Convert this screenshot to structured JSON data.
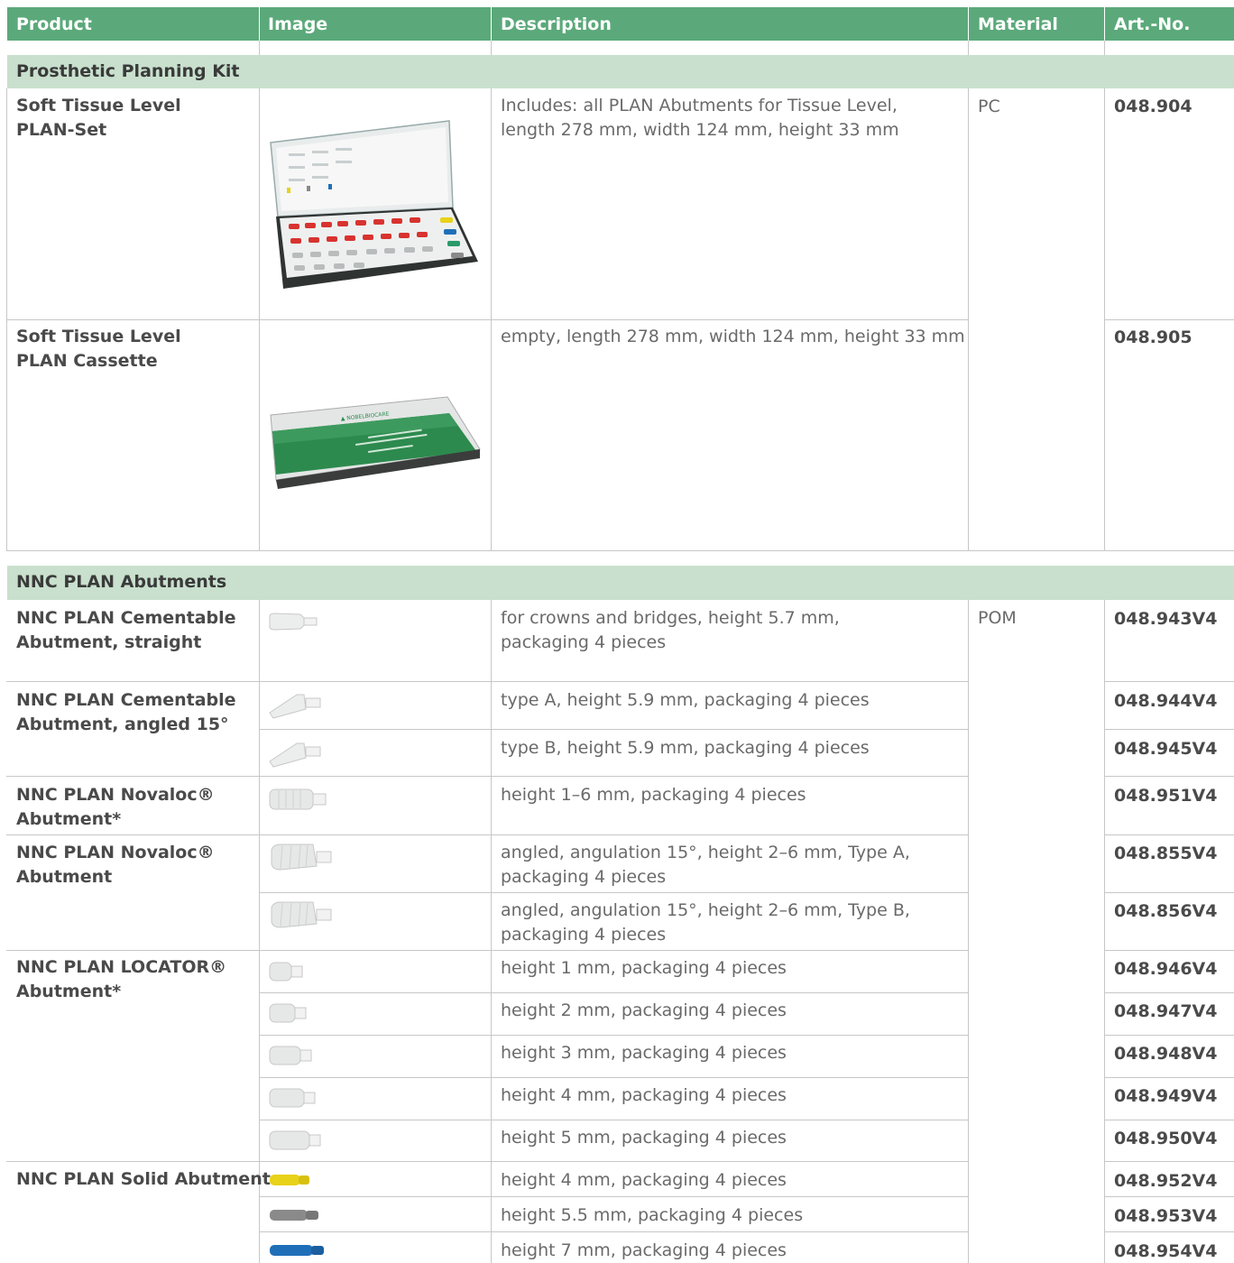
{
  "header": {
    "product": "Product",
    "image": "Image",
    "description": "Description",
    "material": "Material",
    "art_no": "Art.-No."
  },
  "section1": {
    "title": "Prosthetic Planning Kit",
    "rows": [
      {
        "product": [
          "Soft Tissue Level",
          "PLAN-Set"
        ],
        "description": [
          "Includes: all PLAN Abutments for Tissue Level,",
          "length 278 mm, width 124 mm, height 33 mm"
        ],
        "material": "PC",
        "art": "048.904",
        "image": "plan-set-kit-photo"
      },
      {
        "product": [
          "Soft Tissue Level",
          "PLAN Cassette"
        ],
        "description": [
          "empty, length 278 mm, width 124 mm, height 33 mm"
        ],
        "art": "048.905",
        "image": "plan-cassette-photo"
      }
    ]
  },
  "section2": {
    "title": "NNC PLAN Abutments",
    "material": "POM",
    "groups": [
      {
        "product": [
          "NNC PLAN Cementable",
          "Abutment, straight"
        ]
      },
      {
        "product": [
          "NNC PLAN Cementable",
          "Abutment, angled 15°"
        ]
      },
      {
        "product": [
          "NNC PLAN Novaloc®",
          "Abutment*"
        ]
      },
      {
        "product": [
          "NNC PLAN Novaloc®",
          "Abutment"
        ]
      },
      {
        "product": [
          "NNC PLAN LOCATOR®",
          "Abutment*"
        ]
      },
      {
        "product": [
          "NNC PLAN Solid Abutment"
        ]
      }
    ],
    "rows": [
      {
        "description": [
          "for crowns and bridges, height 5.7 mm,",
          "packaging 4 pieces"
        ],
        "art": "048.943V4",
        "image": "cementable-straight-abutment-image"
      },
      {
        "description": [
          "type A, height 5.9 mm, packaging 4 pieces"
        ],
        "art": "048.944V4",
        "image": "cementable-angled-abutment-image"
      },
      {
        "description": [
          "type B, height 5.9 mm, packaging 4 pieces"
        ],
        "art": "048.945V4",
        "image": "cementable-angled-abutment-image"
      },
      {
        "description": [
          "height 1–6 mm, packaging 4 pieces"
        ],
        "art": "048.951V4",
        "image": "novaloc-abutment-image"
      },
      {
        "description": [
          "angled, angulation 15°, height 2–6 mm, Type A,",
          "packaging 4 pieces"
        ],
        "art": "048.855V4",
        "image": "novaloc-angled-abutment-image"
      },
      {
        "description": [
          "angled, angulation 15°, height 2–6 mm, Type B,",
          "packaging 4 pieces"
        ],
        "art": "048.856V4",
        "image": "novaloc-angled-abutment-image"
      },
      {
        "description": [
          "height 1 mm, packaging 4 pieces"
        ],
        "art": "048.946V4",
        "image": "locator-abutment-image"
      },
      {
        "description": [
          "height 2 mm, packaging 4 pieces"
        ],
        "art": "048.947V4",
        "image": "locator-abutment-image"
      },
      {
        "description": [
          "height 3 mm, packaging 4 pieces"
        ],
        "art": "048.948V4",
        "image": "locator-abutment-image"
      },
      {
        "description": [
          "height 4 mm, packaging 4 pieces"
        ],
        "art": "048.949V4",
        "image": "locator-abutment-image"
      },
      {
        "description": [
          "height 5 mm, packaging 4 pieces"
        ],
        "art": "048.950V4",
        "image": "locator-abutment-image"
      },
      {
        "description": [
          "height 4 mm, packaging 4 pieces"
        ],
        "art": "048.952V4",
        "image": "solid-abutment-yellow-image",
        "color": "#e8d21a"
      },
      {
        "description": [
          "height 5.5 mm, packaging 4 pieces"
        ],
        "art": "048.953V4",
        "image": "solid-abutment-grey-image",
        "color": "#8a8a8a"
      },
      {
        "description": [
          "height 7 mm, packaging 4 pieces"
        ],
        "art": "048.954V4",
        "image": "solid-abutment-blue-image",
        "color": "#1f6fb8"
      }
    ]
  },
  "colors": {
    "header_bg": "#5ba97a",
    "section_bg": "#c8e0cd",
    "grid_line": "#c7c7c7"
  }
}
